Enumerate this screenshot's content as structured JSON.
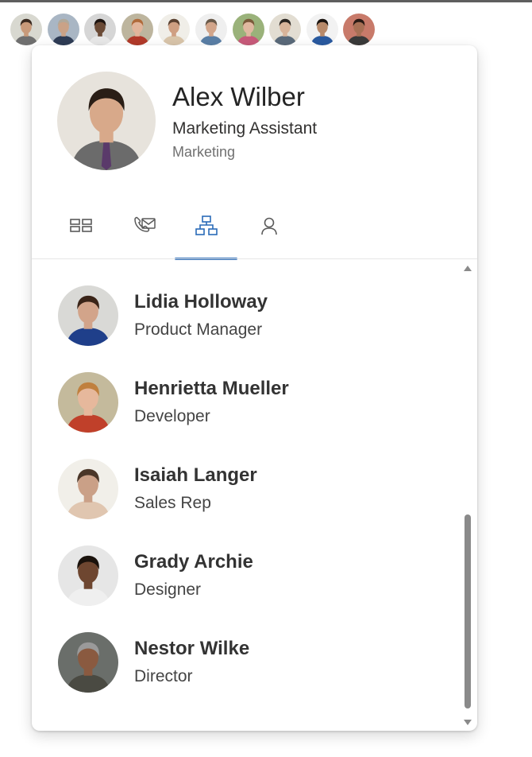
{
  "strip_avatars": [
    {
      "name": "avatar-1",
      "skin": "#c89a7a",
      "hair": "#3a2a20",
      "bg": "#d8d8d0",
      "shirt": "#6f6f6f"
    },
    {
      "name": "avatar-2",
      "skin": "#caa287",
      "hair": "#b0a89a",
      "bg": "#a9b6c4",
      "shirt": "#2e3c55"
    },
    {
      "name": "avatar-3",
      "skin": "#6a4a36",
      "hair": "#1d1410",
      "bg": "#d6d6d6",
      "shirt": "#e8e8e8"
    },
    {
      "name": "avatar-4",
      "skin": "#e2b49a",
      "hair": "#b06a3a",
      "bg": "#bdb59e",
      "shirt": "#b23a2a"
    },
    {
      "name": "avatar-5",
      "skin": "#cf9f82",
      "hair": "#5a4030",
      "bg": "#f0eee8",
      "shirt": "#d9c5aa"
    },
    {
      "name": "avatar-6",
      "skin": "#d2a58a",
      "hair": "#6a5a4a",
      "bg": "#efefef",
      "shirt": "#5a7fa6"
    },
    {
      "name": "avatar-7",
      "skin": "#e0b8a0",
      "hair": "#7a5a3a",
      "bg": "#9ab27a",
      "shirt": "#c85a7a"
    },
    {
      "name": "avatar-8",
      "skin": "#d8b49a",
      "hair": "#2a2420",
      "bg": "#e2ddd2",
      "shirt": "#5a6a7a"
    },
    {
      "name": "avatar-9",
      "skin": "#b88a6a",
      "hair": "#1a1410",
      "bg": "#f2f2f2",
      "shirt": "#2a5aa0"
    },
    {
      "name": "avatar-10",
      "skin": "#a87055",
      "hair": "#2a1a14",
      "bg": "#c87a6a",
      "shirt": "#3a3a3a"
    }
  ],
  "header": {
    "name": "Alex Wilber",
    "title": "Marketing Assistant",
    "department": "Marketing",
    "photo": {
      "skin": "#d8a98a",
      "hair": "#2a1e16",
      "bg": "#e7e3dc",
      "shirt": "#6b6b6b",
      "tie": "#5a3a6a"
    }
  },
  "tabs": [
    {
      "name": "tab-overview",
      "icon": "overview-icon",
      "active": false
    },
    {
      "name": "tab-contact",
      "icon": "contact-icon",
      "active": false
    },
    {
      "name": "tab-organization",
      "icon": "organization-icon",
      "active": true
    },
    {
      "name": "tab-profile",
      "icon": "person-icon",
      "active": false
    }
  ],
  "people": [
    {
      "name": "Lidia Holloway",
      "role": "Product Manager",
      "photo": {
        "skin": "#d2a48a",
        "hair": "#3a2418",
        "bg": "#d9d9d6",
        "shirt": "#1f3f8a"
      }
    },
    {
      "name": "Henrietta Mueller",
      "role": "Developer",
      "photo": {
        "skin": "#e6b89c",
        "hair": "#c0803e",
        "bg": "#c4ba9c",
        "shirt": "#c0402a"
      }
    },
    {
      "name": "Isaiah Langer",
      "role": "Sales Rep",
      "photo": {
        "skin": "#caa087",
        "hair": "#4a3628",
        "bg": "#f1efe9",
        "shirt": "#e0c6b0"
      }
    },
    {
      "name": "Grady Archie",
      "role": "Designer",
      "photo": {
        "skin": "#6e4630",
        "hair": "#1a120c",
        "bg": "#e6e6e6",
        "shirt": "#efefef"
      }
    },
    {
      "name": "Nestor Wilke",
      "role": "Director",
      "photo": {
        "skin": "#8a5a40",
        "hair": "#9a9a9a",
        "bg": "#6a6e6a",
        "shirt": "#4a4a42"
      }
    }
  ],
  "colors": {
    "accent": "#2a6bb8",
    "tab_icon": "#5a5a5a"
  }
}
